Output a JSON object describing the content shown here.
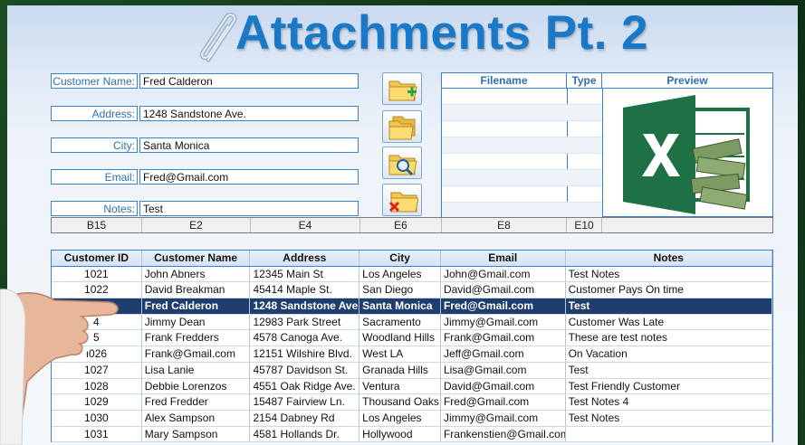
{
  "title": "Attachments Pt. 2",
  "form": {
    "fields": [
      {
        "label": "Customer Name:",
        "value": "Fred Calderon"
      },
      {
        "label": "Address:",
        "value": "1248 Sandstone Ave."
      },
      {
        "label": "City:",
        "value": "Santa Monica"
      },
      {
        "label": "Email:",
        "value": "Fred@Gmail.com"
      },
      {
        "label": "Notes:",
        "value": "Test"
      }
    ],
    "buttons": [
      "add-folder-icon",
      "open-folder-icon",
      "search-folder-icon",
      "delete-folder-icon"
    ]
  },
  "cell_refs": [
    "B15",
    "E2",
    "E4",
    "E6",
    "E8",
    "E10"
  ],
  "files_table": {
    "headers": [
      "Filename",
      "Type",
      "Preview"
    ],
    "preview_icon": "excel-icon"
  },
  "customers": {
    "headers": [
      "Customer ID",
      "Customer Name",
      "Address",
      "City",
      "Email",
      "Notes"
    ],
    "selected_index": 2,
    "rows": [
      [
        "1021",
        "John Abners",
        "12345 Main St",
        "Los Angeles",
        "John@Gmail.com",
        "Test Notes"
      ],
      [
        "1022",
        "David Breakman",
        "45414 Maple St.",
        "San Diego",
        "David@Gmail.com",
        "Customer Pays On time"
      ],
      [
        "",
        "Fred Calderon",
        "1248 Sandstone Ave.",
        "Santa Monica",
        "Fred@Gmail.com",
        "Test"
      ],
      [
        "4",
        "Jimmy Dean",
        "12983 Park Street",
        "Sacramento",
        "Jimmy@Gmail.com",
        "Customer Was Late"
      ],
      [
        "5",
        "Frank Fredders",
        "4578 Canoga  Ave.",
        "Woodland Hills",
        "Frank@Gmail.com",
        "These are test notes"
      ],
      [
        "ı026",
        "Frank@Gmail.com",
        "12151 Wilshire Blvd.",
        "West LA",
        "Jeff@Gmail.com",
        "On Vacation"
      ],
      [
        "1027",
        "Lisa Lanie",
        "45787 Davidson St.",
        "Granada Hills",
        "Lisa@Gmail.com",
        "Test"
      ],
      [
        "1028",
        "Debbie Lorenzos",
        "4551 Oak Ridge Ave.",
        "Ventura",
        "David@Gmail.com",
        "Test Friendly Customer"
      ],
      [
        "1029",
        "Fred Fredder",
        "15487 Fairview Ln.",
        "Thousand Oaks",
        "Fred@Gmail.com",
        "Test Notes 4"
      ],
      [
        "1030",
        "Alex Sampson",
        "2154 Dabney Rd",
        "Los Angeles",
        "Jimmy@Gmail.com",
        "Test Notes"
      ],
      [
        "1031",
        "Mary Sampson",
        "4581 Hollands Dr.",
        "Hollywood",
        "Frankenstien@Gmail.com",
        ""
      ]
    ]
  }
}
